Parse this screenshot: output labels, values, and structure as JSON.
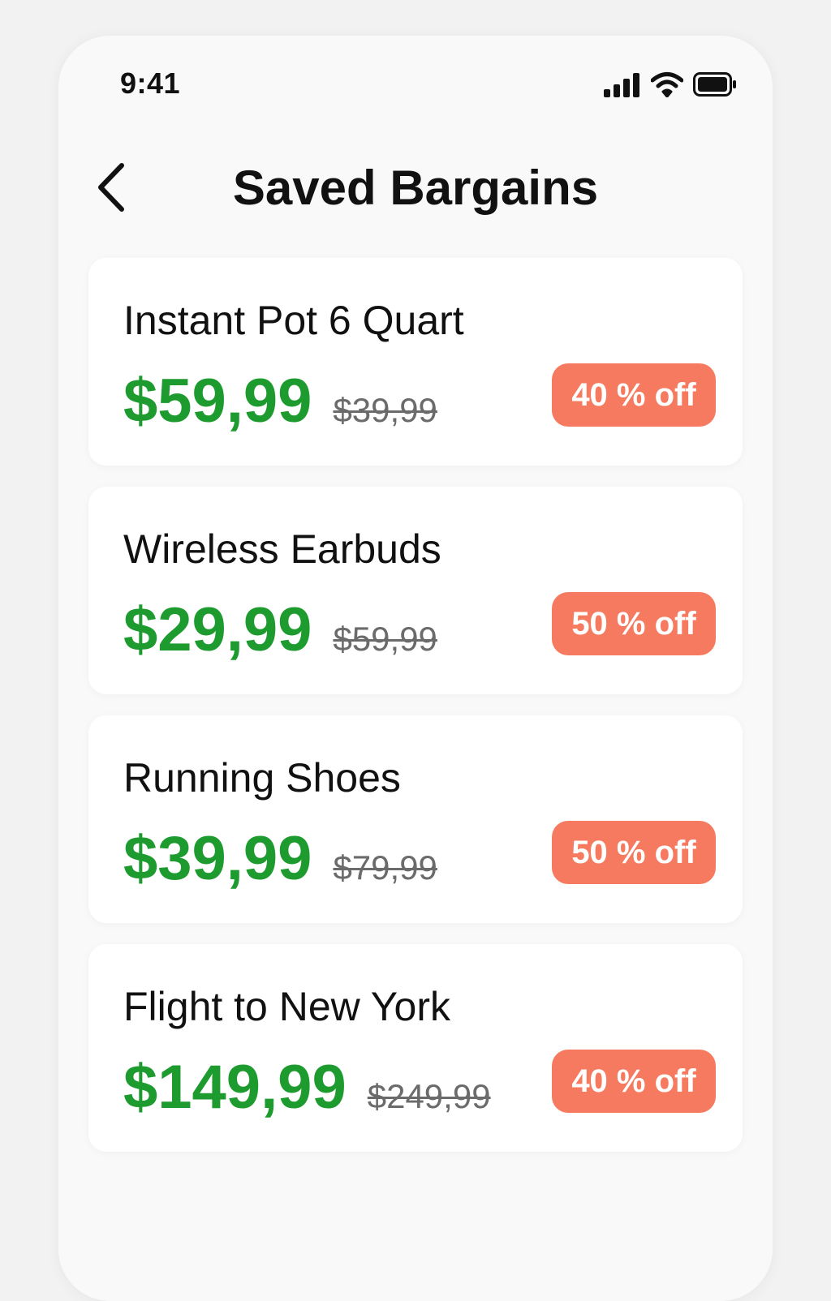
{
  "status_bar": {
    "time": "9:41",
    "icons": [
      "signal-icon",
      "wifi-icon",
      "battery-icon"
    ]
  },
  "header": {
    "back_icon": "chevron-left-icon",
    "title": "Saved Bargains"
  },
  "bargains": [
    {
      "name": "Instant Pot 6 Quart",
      "price": "$59,99",
      "original_price": "$39,99",
      "discount": "40 % off"
    },
    {
      "name": "Wireless Earbuds",
      "price": "$29,99",
      "original_price": "$59,99",
      "discount": "50 % off"
    },
    {
      "name": "Running Shoes",
      "price": "$39,99",
      "original_price": "$79,99",
      "discount": "50 % off"
    },
    {
      "name": "Flight to New York",
      "price": "$149,99",
      "original_price": "$249,99",
      "discount": "40 % off"
    }
  ],
  "colors": {
    "price": "#1e9b2e",
    "original_price": "#6b6b6b",
    "badge_background": "#f57a5f",
    "badge_text": "#ffffff",
    "card_background": "#ffffff",
    "screen_background": "#f9f9f9"
  }
}
